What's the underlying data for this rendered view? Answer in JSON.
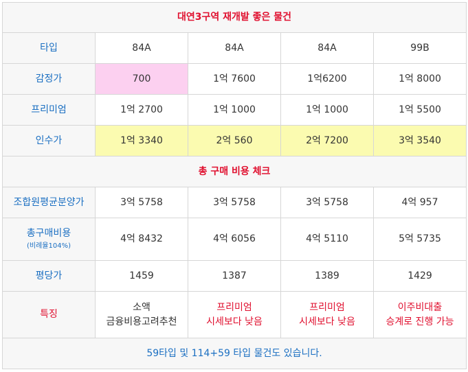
{
  "title": "대연3구역 재개발 좋은 물건",
  "type_row": {
    "label": "타입",
    "values": [
      "84A",
      "84A",
      "84A",
      "99B"
    ]
  },
  "appraisal_row": {
    "label": "감정가",
    "values": [
      "700",
      "1억 7600",
      "1억6200",
      "1억 8000"
    ]
  },
  "premium_row": {
    "label": "프리미엄",
    "values": [
      "1억 2700",
      "1억 1000",
      "1억 1000",
      "1억 5500"
    ]
  },
  "acquisition_row": {
    "label": "인수가",
    "values": [
      "1억 3340",
      "2억 560",
      "2억 7200",
      "3억 3540"
    ]
  },
  "section_title": "총 구매 비용 체크",
  "member_price_row": {
    "label": "조합원평균분양가",
    "values": [
      "3억 5758",
      "3억 5758",
      "3억 5758",
      "4억 957"
    ]
  },
  "total_cost_row": {
    "label": "총구매비용",
    "sublabel": "(비례율104%)",
    "values": [
      "4억 8432",
      "4억 6056",
      "4억 5110",
      "5억 5735"
    ]
  },
  "per_pyeong_row": {
    "label": "평당가",
    "values": [
      "1459",
      "1387",
      "1389",
      "1429"
    ]
  },
  "features_row": {
    "label": "특징",
    "values": [
      {
        "line1": "소액",
        "line2": "금융비용고려추천"
      },
      {
        "line1": "프리미엄",
        "line2": "시세보다 낮음"
      },
      {
        "line1": "프리미엄",
        "line2": "시세보다 낮음"
      },
      {
        "line1": "이주비대출",
        "line2": "승계로 진행 가능"
      }
    ]
  },
  "footer": "59타입 및 114+59 타입 물건도 있습니다.",
  "colors": {
    "label_blue": "#1b6fc2",
    "accent_red": "#e0102f",
    "pink_highlight": "#fcd0f0",
    "yellow_highlight": "#fbfbb0"
  }
}
